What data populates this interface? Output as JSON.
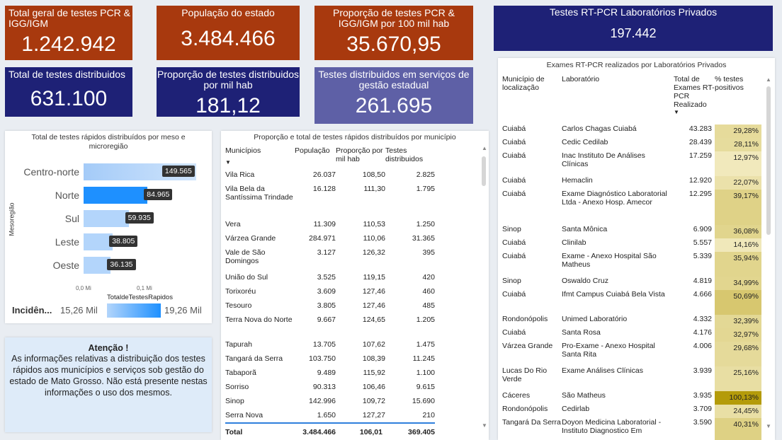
{
  "kpis": {
    "total_tests_label": "Total geral de testes PCR & IGG/IGM",
    "total_tests_value": "1.242.942",
    "population_label": "População do estado",
    "population_value": "3.484.466",
    "pcr_ratio_label": "Proporção de testes PCR & IGG/IGM por 100 mil hab",
    "pcr_ratio_value": "35.670,95",
    "private_lab_label": "Testes RT-PCR Laboratórios Privados",
    "private_lab_value": "197.442",
    "distributed_label": "Total de testes distribuidos",
    "distributed_value": "631.100",
    "dist_ratio_label": "Proporção de testes distribuidos por mil hab",
    "dist_ratio_value": "181,12",
    "state_services_label": "Testes distribuidos em serviços de gestão estadual",
    "state_services_value": "261.695"
  },
  "colors": {
    "brown": "#a8390e",
    "navy": "#1e2176",
    "purple": "#5e60a6",
    "bar_dark": "#1e90ff",
    "bar_light": "#b3d5fb"
  },
  "chart_data": {
    "type": "bar",
    "orientation": "horizontal",
    "title": "Total de testes rápidos distribuídos por meso e microregião",
    "categories": [
      "Centro-norte",
      "Norte",
      "Sul",
      "Leste",
      "Oeste"
    ],
    "values": [
      149565,
      84965,
      59935,
      38805,
      36135
    ],
    "value_labels": [
      "149.565",
      "84.965",
      "59.935",
      "38.805",
      "36.135"
    ],
    "xlabel": "TotaldeTestesRapidos",
    "ylabel": "Mesoregião",
    "x_ticks": [
      "0,0 Mi",
      "0,1 Mi"
    ],
    "xlim": [
      0,
      0.16
    ],
    "color_by": "Incidência",
    "color_scale_label": "Incidên...",
    "color_min": "15,26 Mil",
    "color_max": "19,26 Mil"
  },
  "notice": {
    "title": "Atenção !",
    "body": "As informações relativas a distribuição dos testes rápidos aos municípios e serviços sob gestão do estado de Mato Grosso. Não está presente nestas informações o uso dos mesmos."
  },
  "municipal_table": {
    "title": "Proporção e total de testes rápidos distribuídos por município",
    "columns": [
      "Municípios",
      "População",
      "Proporção por mil hab",
      "Testes distribuidos"
    ],
    "rows": [
      [
        "Vila Rica",
        "26.037",
        "108,50",
        "2.825"
      ],
      [
        "Vila Bela da Santíssima Trindade",
        "16.128",
        "111,30",
        "1.795"
      ],
      [
        "Vera",
        "11.309",
        "110,53",
        "1.250"
      ],
      [
        "Várzea Grande",
        "284.971",
        "110,06",
        "31.365"
      ],
      [
        "Vale de São Domingos",
        "3.127",
        "126,32",
        "395"
      ],
      [
        "União do Sul",
        "3.525",
        "119,15",
        "420"
      ],
      [
        "Torixoréu",
        "3.609",
        "127,46",
        "460"
      ],
      [
        "Tesouro",
        "3.805",
        "127,46",
        "485"
      ],
      [
        "Terra Nova do Norte",
        "9.667",
        "124,65",
        "1.205"
      ],
      [
        "Tapurah",
        "13.705",
        "107,62",
        "1.475"
      ],
      [
        "Tangará da Serra",
        "103.750",
        "108,39",
        "11.245"
      ],
      [
        "Tabaporã",
        "9.489",
        "115,92",
        "1.100"
      ],
      [
        "Sorriso",
        "90.313",
        "106,46",
        "9.615"
      ],
      [
        "Sinop",
        "142.996",
        "109,72",
        "15.690"
      ],
      [
        "Serra Nova",
        "1.650",
        "127,27",
        "210"
      ]
    ],
    "total": [
      "Total",
      "3.484.466",
      "106,01",
      "369.405"
    ]
  },
  "lab_table": {
    "title": "Exames RT-PCR realizados por Laboratórios Privados",
    "columns": [
      "Município de localização",
      "Laboratório",
      "Total de Exames RT-PCR Realizado",
      "% testes positivos"
    ],
    "rows": [
      [
        "Cuiabá",
        "Carlos Chagas Cuiabá",
        "43.283",
        "29,28%",
        29.28
      ],
      [
        "Cuiabá",
        "Cedic Cedilab",
        "28.439",
        "28,11%",
        28.11
      ],
      [
        "Cuiabá",
        "Inac Instituto De Análises Clínicas",
        "17.259",
        "12,97%",
        12.97
      ],
      [
        "Cuiabá",
        "Hemaclin",
        "12.920",
        "22,07%",
        22.07
      ],
      [
        "Cuiabá",
        "Exame Diagnóstico Laboratorial Ltda - Anexo Hosp. Amecor",
        "12.295",
        "39,17%",
        39.17
      ],
      [
        "Sinop",
        "Santa Mônica",
        "6.909",
        "36,08%",
        36.08
      ],
      [
        "Cuiabá",
        "Clinilab",
        "5.557",
        "14,16%",
        14.16
      ],
      [
        "Cuiabá",
        "Exame - Anexo Hospital São Matheus",
        "5.339",
        "35,94%",
        35.94
      ],
      [
        "Sinop",
        "Oswaldo Cruz",
        "4.819",
        "34,99%",
        34.99
      ],
      [
        "Cuiabá",
        "Ifmt Campus Cuiabá Bela Vista",
        "4.666",
        "50,69%",
        50.69
      ],
      [
        "Rondonópolis",
        "Unimed Laboratório",
        "4.332",
        "32,39%",
        32.39
      ],
      [
        "Cuiabá",
        "Santa Rosa",
        "4.176",
        "32,97%",
        32.97
      ],
      [
        "Várzea Grande",
        "Pro-Exame - Anexo Hospital Santa Rita",
        "4.006",
        "29,68%",
        29.68
      ],
      [
        "Lucas Do Rio Verde",
        "Exame Análises Clínicas",
        "3.939",
        "25,16%",
        25.16
      ],
      [
        "Cáceres",
        "São Matheus",
        "3.935",
        "100,13%",
        100.13
      ],
      [
        "Rondonópolis",
        "Cedirlab",
        "3.709",
        "24,45%",
        24.45
      ],
      [
        "Tangará Da Serra",
        "Doyon Medicina Laboratorial - Instituto Diagnostico Em",
        "3.590",
        "40,31%",
        40.31
      ]
    ]
  }
}
